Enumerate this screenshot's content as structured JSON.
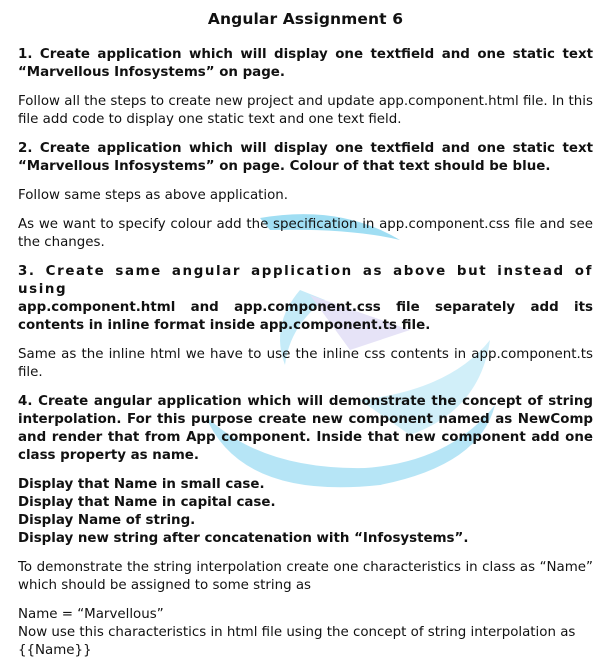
{
  "title": "Angular Assignment 6",
  "q1": {
    "heading": "1. Create application which will display one textfield and one static text “Marvellous Infosystems” on page.",
    "body": "Follow all the steps to create new project and update app.component.html file. In this file add code to display one static text and one text field."
  },
  "q2": {
    "heading": "2. Create application which will display one textfield and one static text “Marvellous Infosystems” on page. Colour of that text should be blue.",
    "body1": "Follow same steps as above application.",
    "body2": "As we want to specify colour add the specification in app.component.css file and see the changes."
  },
  "q3": {
    "heading_line1": "3. Create same angular application as above but instead of using",
    "heading_rest": "app.component.html and app.component.css file separately add its contents in inline format inside app.component.ts file.",
    "body": "Same as the inline html we have to use the inline css contents in app.component.ts file."
  },
  "q4": {
    "heading": "4. Create angular application which will demonstrate the concept of string interpolation. For this purpose create new component named as NewComp and render that from App component. Inside that new component add one class property as name.",
    "items": [
      "Display that Name in small case.",
      "Display that Name in capital case.",
      "Display Name of string.",
      "Display new string after concatenation with “Infosystems”."
    ],
    "body": "To demonstrate the string interpolation create one characteristics in class as “Name” which should be assigned to some string as",
    "code_line": "Name = “Marvellous”",
    "body2": "Now use this characteristics in html file using the concept of string interpolation as",
    "code_line2": "{{Name}}"
  },
  "watermark": {
    "color_light": "#cdeff9",
    "color_mid": "#7fd3f0"
  }
}
